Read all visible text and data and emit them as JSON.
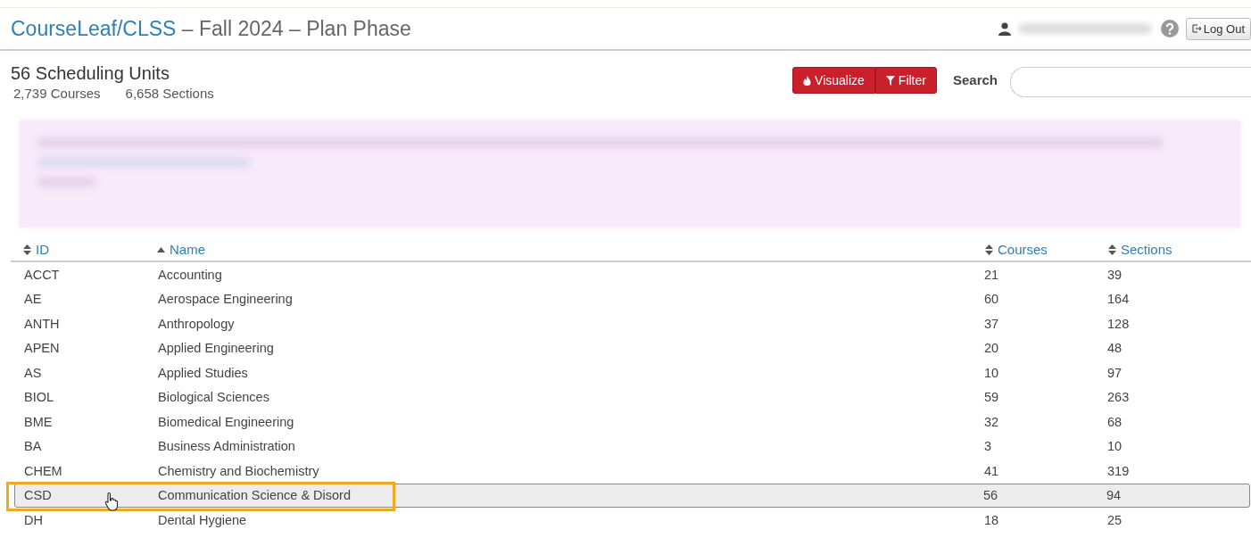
{
  "header": {
    "brand": "CourseLeaf/CLSS",
    "title": " – Fall 2024 – Plan Phase",
    "logout": "Log Out"
  },
  "summary": {
    "title": "56 Scheduling Units",
    "courses": "2,739 Courses",
    "sections": "6,658 Sections"
  },
  "toolbar": {
    "buttons": [
      "Visualize",
      "Filter"
    ],
    "search_label": "Search"
  },
  "table": {
    "columns": [
      {
        "label": "ID",
        "sorted": false
      },
      {
        "label": "Name",
        "sorted": true
      },
      {
        "label": "Courses",
        "sorted": false
      },
      {
        "label": "Sections",
        "sorted": false
      }
    ],
    "rows": [
      {
        "id": "ACCT",
        "name": "Accounting",
        "courses": "21",
        "sections": "39",
        "selected": false,
        "highlighted": false
      },
      {
        "id": "AE",
        "name": "Aerospace Engineering",
        "courses": "60",
        "sections": "164",
        "selected": false,
        "highlighted": false
      },
      {
        "id": "ANTH",
        "name": "Anthropology",
        "courses": "37",
        "sections": "128",
        "selected": false,
        "highlighted": false
      },
      {
        "id": "APEN",
        "name": "Applied Engineering",
        "courses": "20",
        "sections": "48",
        "selected": false,
        "highlighted": false
      },
      {
        "id": "AS",
        "name": "Applied Studies",
        "courses": "10",
        "sections": "97",
        "selected": false,
        "highlighted": false
      },
      {
        "id": "BIOL",
        "name": "Biological Sciences",
        "courses": "59",
        "sections": "263",
        "selected": false,
        "highlighted": false
      },
      {
        "id": "BME",
        "name": "Biomedical Engineering",
        "courses": "32",
        "sections": "68",
        "selected": false,
        "highlighted": false
      },
      {
        "id": "BA",
        "name": "Business Administration",
        "courses": "3",
        "sections": "10",
        "selected": false,
        "highlighted": false
      },
      {
        "id": "CHEM",
        "name": "Chemistry and Biochemistry",
        "courses": "41",
        "sections": "319",
        "selected": false,
        "highlighted": false
      },
      {
        "id": "CSD",
        "name": "Communication Science & Disord",
        "courses": "56",
        "sections": "94",
        "selected": true,
        "highlighted": true
      },
      {
        "id": "DH",
        "name": "Dental Hygiene",
        "courses": "18",
        "sections": "25",
        "selected": false,
        "highlighted": false
      }
    ]
  }
}
